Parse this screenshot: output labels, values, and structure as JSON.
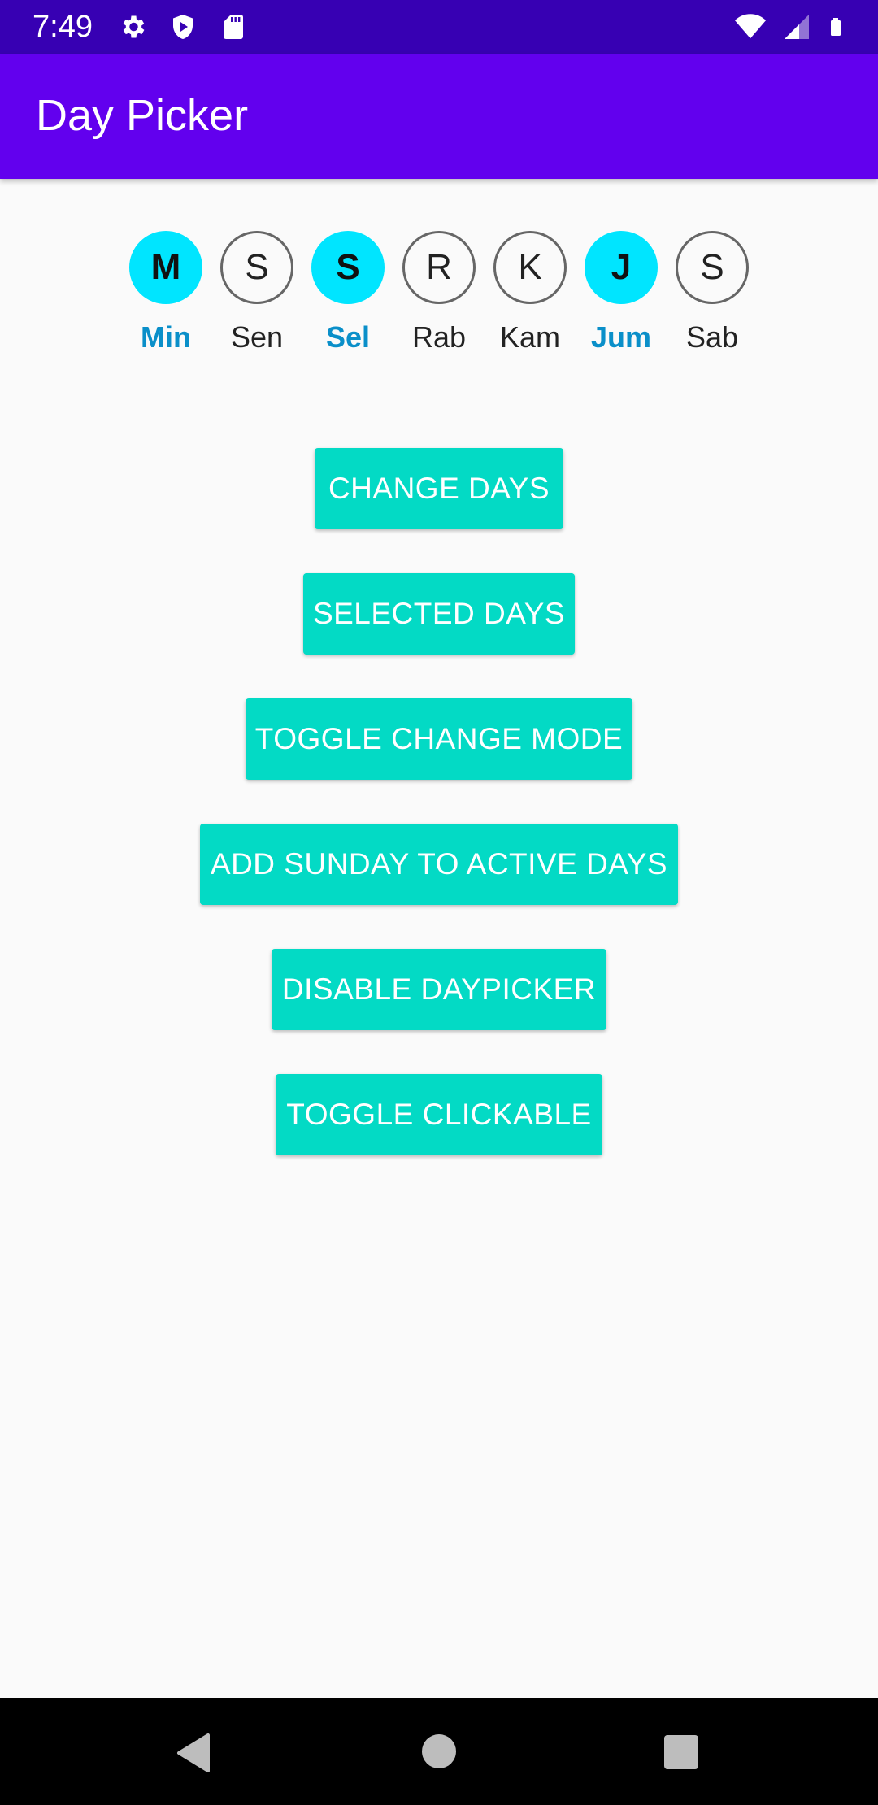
{
  "status_bar": {
    "time": "7:49",
    "left_icons": [
      "settings-icon",
      "shield-play-icon",
      "sd-card-icon"
    ],
    "right_icons": [
      "wifi-icon",
      "cellular-signal-icon",
      "battery-icon"
    ]
  },
  "app_bar": {
    "title": "Day Picker"
  },
  "day_picker": {
    "days": [
      {
        "letter": "M",
        "label": "Min",
        "selected": true
      },
      {
        "letter": "S",
        "label": "Sen",
        "selected": false
      },
      {
        "letter": "S",
        "label": "Sel",
        "selected": true
      },
      {
        "letter": "R",
        "label": "Rab",
        "selected": false
      },
      {
        "letter": "K",
        "label": "Kam",
        "selected": false
      },
      {
        "letter": "J",
        "label": "Jum",
        "selected": true
      },
      {
        "letter": "S",
        "label": "Sab",
        "selected": false
      }
    ]
  },
  "buttons": {
    "change_days": "CHANGE DAYS",
    "selected_days": "SELECTED DAYS",
    "toggle_change_mode": "TOGGLE CHANGE MODE",
    "add_sunday": "ADD SUNDAY TO ACTIVE DAYS",
    "disable_daypicker": "DISABLE DAYPICKER",
    "toggle_clickable": "TOGGLE CLICKABLE"
  },
  "colors": {
    "status_bar": "#3700b3",
    "app_bar": "#6200ee",
    "selected_day": "#00e5ff",
    "selected_label": "#0a8fc9",
    "button": "#03dac5"
  },
  "nav_bar": {
    "icons": [
      "back-icon",
      "home-icon",
      "recents-icon"
    ]
  }
}
